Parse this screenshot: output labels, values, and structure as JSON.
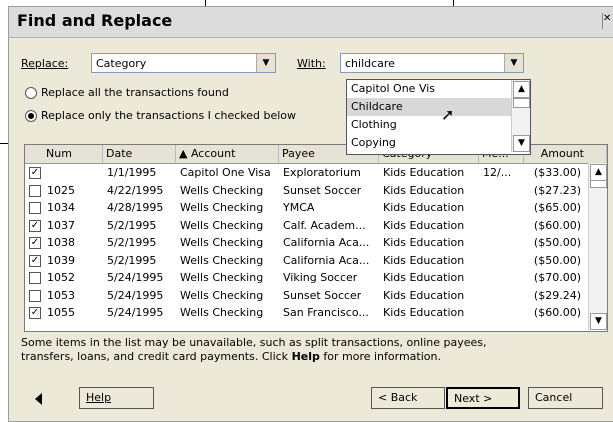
{
  "dialog": {
    "title": "Find and Replace"
  },
  "replace": {
    "label": "Replace:",
    "value": "Category"
  },
  "with": {
    "label": "With:",
    "value": "childcare"
  },
  "radios": [
    {
      "label": "Replace all the transactions found",
      "checked": false
    },
    {
      "label": "Replace only the transactions I checked below",
      "checked": true
    }
  ],
  "dropdown": {
    "items": [
      "Capitol One Vis",
      "Childcare",
      "Clothing",
      "Copying"
    ],
    "selected_index": 1
  },
  "table": {
    "columns": [
      "Num",
      "Date",
      "Account",
      "Payee",
      "Category",
      "Me...",
      "Amount"
    ],
    "rows": [
      {
        "checked": true,
        "num": "",
        "date": "1/1/1995",
        "account": "Capitol One Visa",
        "payee": "Exploratorium",
        "category": "Kids Education",
        "memo": "12/...",
        "amount": "($33.00)"
      },
      {
        "checked": false,
        "num": "1025",
        "date": "4/22/1995",
        "account": "Wells Checking",
        "payee": "Sunset Soccer",
        "category": "Kids Education",
        "memo": "",
        "amount": "($27.23)"
      },
      {
        "checked": false,
        "num": "1034",
        "date": "4/28/1995",
        "account": "Wells Checking",
        "payee": "YMCA",
        "category": "Kids Education",
        "memo": "",
        "amount": "($65.00)"
      },
      {
        "checked": true,
        "num": "1037",
        "date": "5/2/1995",
        "account": "Wells Checking",
        "payee": "Calf. Academ...",
        "category": "Kids Education",
        "memo": "",
        "amount": "($60.00)"
      },
      {
        "checked": true,
        "num": "1038",
        "date": "5/2/1995",
        "account": "Wells Checking",
        "payee": "California Aca...",
        "category": "Kids Education",
        "memo": "",
        "amount": "($50.00)"
      },
      {
        "checked": true,
        "num": "1039",
        "date": "5/2/1995",
        "account": "Wells Checking",
        "payee": "California Aca...",
        "category": "Kids Education",
        "memo": "",
        "amount": "($50.00)"
      },
      {
        "checked": false,
        "num": "1052",
        "date": "5/24/1995",
        "account": "Wells Checking",
        "payee": "Viking Soccer",
        "category": "Kids Education",
        "memo": "",
        "amount": "($70.00)"
      },
      {
        "checked": false,
        "num": "1053",
        "date": "5/24/1995",
        "account": "Wells Checking",
        "payee": "Sunset Soccer",
        "category": "Kids Education",
        "memo": "",
        "amount": "($29.24)"
      },
      {
        "checked": true,
        "num": "1055",
        "date": "5/24/1995",
        "account": "Wells Checking",
        "payee": "San Francisco...",
        "category": "Kids Education",
        "memo": "",
        "amount": "($60.00)"
      }
    ]
  },
  "note": {
    "line1": "Some items in the list may be unavailable, such as split transactions, online payees,",
    "line2_pre": "transfers, loans, and credit card payments. Click ",
    "line2_bold": "Help",
    "line2_post": " for more information."
  },
  "buttons": {
    "help": "Help",
    "back": "< Back",
    "next": "Next >",
    "cancel": "Cancel"
  }
}
